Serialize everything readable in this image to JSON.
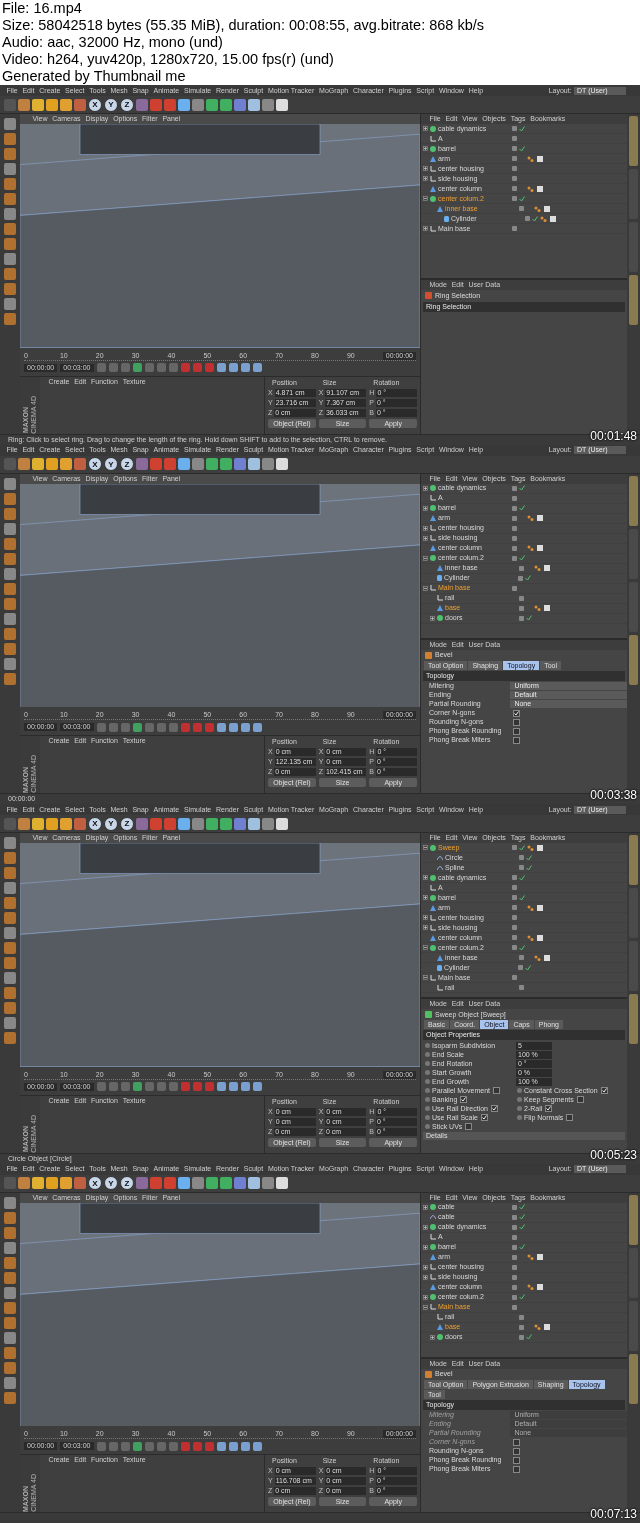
{
  "header": {
    "lines": [
      "File: 16.mp4",
      "Size: 58042518 bytes (55.35 MiB), duration: 00:08:55, avg.bitrate: 868 kb/s",
      "Audio: aac, 32000 Hz, mono (und)",
      "Video: h264, yuv420p, 1280x720, 15.00 fps(r) (und)",
      "Generated by Thumbnail me"
    ]
  },
  "frames": [
    {
      "timestamp": "00:01:48",
      "menu": [
        "File",
        "Edit",
        "Create",
        "Select",
        "Tools",
        "Mesh",
        "Snap",
        "Animate",
        "Simulate",
        "Render",
        "Sculpt",
        "Motion Tracker",
        "MoGraph",
        "Character",
        "Plugins",
        "Script",
        "Window",
        "Help"
      ],
      "layout_label": "Layout:",
      "layout_value": "DT (User)",
      "axis_buttons": [
        "X",
        "Y",
        "Z"
      ],
      "viewport_menu": [
        "View",
        "Cameras",
        "Display",
        "Options",
        "Filter",
        "Panel"
      ],
      "object_menu": [
        "File",
        "Edit",
        "View",
        "Objects",
        "Tags",
        "Bookmarks"
      ],
      "objects": [
        {
          "name": "cable dynamics",
          "kind": "sphere",
          "selected": false,
          "expanded": false,
          "check": true,
          "tags": false
        },
        {
          "name": "A",
          "kind": "null",
          "selected": false,
          "check": false,
          "tags": false
        },
        {
          "name": "barrel",
          "kind": "sphere",
          "selected": false,
          "expanded": false,
          "check": true,
          "tags": false
        },
        {
          "name": "arm",
          "kind": "bend",
          "selected": false,
          "check": false,
          "tags": true
        },
        {
          "name": "center housing",
          "kind": "null",
          "selected": false,
          "expanded": false,
          "check": false,
          "tags": false
        },
        {
          "name": "side housing",
          "kind": "null",
          "selected": false,
          "expanded": false,
          "check": false,
          "tags": false
        },
        {
          "name": "center column",
          "kind": "bend",
          "selected": false,
          "check": false,
          "tags": true
        },
        {
          "name": "center colum.2",
          "kind": "sphere",
          "selected": true,
          "expanded": true,
          "check": true,
          "tags": false,
          "children": [
            {
              "name": "inner base",
              "kind": "bend",
              "selected": true,
              "check": false,
              "tags": true,
              "children": [
                {
                  "name": "Cylinder",
                  "kind": "cylinder",
                  "selected": false,
                  "check": true,
                  "tags": true
                }
              ]
            }
          ]
        },
        {
          "name": "Main base",
          "kind": "null",
          "selected": false,
          "expanded": false,
          "check": false,
          "tags": false
        }
      ],
      "attr_menu": [
        "Mode",
        "Edit",
        "User Data"
      ],
      "attributes": {
        "kind": "ring",
        "title": "Ring Selection",
        "section": "Ring Selection"
      },
      "timeline": {
        "ticks": [
          "0",
          "10",
          "20",
          "30",
          "40",
          "50",
          "60",
          "70",
          "80",
          "90"
        ],
        "current": "00:00:00",
        "start": "00:00:00",
        "end": "00:03:00"
      },
      "material_menu": [
        "Create",
        "Edit",
        "Function",
        "Texture"
      ],
      "coords": {
        "headers": [
          "Position",
          "Size",
          "Rotation"
        ],
        "rows": [
          {
            "axis": "X",
            "position": "4.871 cm",
            "size_axis": "X",
            "size": "91.107 cm",
            "rot_axis": "H",
            "rotation": "0 °"
          },
          {
            "axis": "Y",
            "position": "23.716 cm",
            "size_axis": "Y",
            "size": "7.367 cm",
            "rot_axis": "P",
            "rotation": "0 °"
          },
          {
            "axis": "Z",
            "position": "0 cm",
            "size_axis": "Z",
            "size": "36.033 cm",
            "rot_axis": "B",
            "rotation": "0 °"
          }
        ],
        "mode": "Object (Rel)",
        "size_mode": "Size",
        "apply": "Apply"
      },
      "logo": [
        "MAXON",
        "CINEMA 4D"
      ],
      "status": "Ring: Click to select ring. Drag to change the length of the ring. Hold down SHIFT to add to the selection, CTRL to remove."
    },
    {
      "timestamp": "00:03:38",
      "menu": [
        "File",
        "Edit",
        "Create",
        "Select",
        "Tools",
        "Mesh",
        "Snap",
        "Animate",
        "Simulate",
        "Render",
        "Sculpt",
        "Motion Tracker",
        "MoGraph",
        "Character",
        "Plugins",
        "Script",
        "Window",
        "Help"
      ],
      "layout_label": "Layout:",
      "layout_value": "DT (User)",
      "axis_buttons": [
        "X",
        "Y",
        "Z"
      ],
      "viewport_menu": [
        "View",
        "Cameras",
        "Display",
        "Options",
        "Filter",
        "Panel"
      ],
      "object_menu": [
        "File",
        "Edit",
        "View",
        "Objects",
        "Tags",
        "Bookmarks"
      ],
      "objects": [
        {
          "name": "cable dynamics",
          "kind": "sphere",
          "selected": false,
          "expanded": false,
          "check": true,
          "tags": false
        },
        {
          "name": "A",
          "kind": "null",
          "selected": false,
          "check": false,
          "tags": false
        },
        {
          "name": "barrel",
          "kind": "sphere",
          "selected": false,
          "expanded": false,
          "check": true,
          "tags": false
        },
        {
          "name": "arm",
          "kind": "bend",
          "selected": false,
          "check": false,
          "tags": true
        },
        {
          "name": "center housing",
          "kind": "null",
          "selected": false,
          "expanded": false,
          "check": false,
          "tags": false
        },
        {
          "name": "side housing",
          "kind": "null",
          "selected": false,
          "expanded": false,
          "check": false,
          "tags": false
        },
        {
          "name": "center column",
          "kind": "bend",
          "selected": false,
          "check": false,
          "tags": true
        },
        {
          "name": "center colum.2",
          "kind": "sphere",
          "selected": false,
          "expanded": true,
          "check": true,
          "tags": false,
          "children": [
            {
              "name": "inner base",
              "kind": "bend",
              "selected": false,
              "check": false,
              "tags": true
            },
            {
              "name": "Cylinder",
              "kind": "cylinder",
              "selected": false,
              "check": true,
              "tags": false
            }
          ]
        },
        {
          "name": "Main base",
          "kind": "null",
          "selected": true,
          "expanded": true,
          "check": false,
          "tags": false,
          "children": [
            {
              "name": "rail",
              "kind": "null",
              "selected": false,
              "check": false,
              "tags": false
            },
            {
              "name": "base",
              "kind": "bend",
              "selected": true,
              "check": false,
              "tags": true
            },
            {
              "name": "doors",
              "kind": "sphere",
              "selected": false,
              "expanded": false,
              "check": true,
              "tags": false
            }
          ]
        }
      ],
      "attr_menu": [
        "Mode",
        "Edit",
        "User Data"
      ],
      "attributes": {
        "kind": "bevel",
        "title": "Bevel",
        "tabs": [
          {
            "label": "Tool Option",
            "selected": false
          },
          {
            "label": "Shaping",
            "selected": false
          },
          {
            "label": "Topology",
            "selected": true
          },
          {
            "label": "Tool",
            "selected": false
          }
        ],
        "section": "Topology",
        "fields": [
          {
            "kind": "dropdown",
            "label": "Mitering",
            "value": "Uniform",
            "disabled": false
          },
          {
            "kind": "dropdown",
            "label": "Ending",
            "value": "Default",
            "disabled": false
          },
          {
            "kind": "dropdown",
            "label": "Partial Rounding",
            "value": "None",
            "disabled": false
          },
          {
            "kind": "checkbox",
            "label": "Corner N-gons",
            "checked": true,
            "disabled": false
          },
          {
            "kind": "checkbox",
            "label": "Rounding N-gons",
            "checked": false,
            "disabled": false
          },
          {
            "kind": "checkbox",
            "label": "Phong Break Rounding",
            "checked": false,
            "disabled": false
          },
          {
            "kind": "checkbox",
            "label": "Phong Break Miters",
            "checked": false,
            "disabled": false
          }
        ]
      },
      "timeline": {
        "ticks": [
          "0",
          "10",
          "20",
          "30",
          "40",
          "50",
          "60",
          "70",
          "80",
          "90"
        ],
        "current": "00:00:00",
        "start": "00:00:00",
        "end": "00:03:00"
      },
      "material_menu": [
        "Create",
        "Edit",
        "Function",
        "Texture"
      ],
      "coords": {
        "headers": [
          "Position",
          "Size",
          "Rotation"
        ],
        "rows": [
          {
            "axis": "X",
            "position": "0 cm",
            "size_axis": "X",
            "size": "0 cm",
            "rot_axis": "H",
            "rotation": "0 °"
          },
          {
            "axis": "Y",
            "position": "122.135 cm",
            "size_axis": "Y",
            "size": "0 cm",
            "rot_axis": "P",
            "rotation": "0 °"
          },
          {
            "axis": "Z",
            "position": "0 cm",
            "size_axis": "Z",
            "size": "102.415 cm",
            "rot_axis": "B",
            "rotation": "0 °"
          }
        ],
        "mode": "Object (Rel)",
        "size_mode": "Size",
        "apply": "Apply"
      },
      "logo": [
        "MAXON",
        "CINEMA 4D"
      ],
      "status": "00:00:00"
    },
    {
      "timestamp": "00:05:23",
      "menu": [
        "File",
        "Edit",
        "Create",
        "Select",
        "Tools",
        "Mesh",
        "Snap",
        "Animate",
        "Simulate",
        "Render",
        "Sculpt",
        "Motion Tracker",
        "MoGraph",
        "Character",
        "Plugins",
        "Script",
        "Window",
        "Help"
      ],
      "layout_label": "Layout:",
      "layout_value": "DT (User)",
      "axis_buttons": [
        "X",
        "Y",
        "Z"
      ],
      "viewport_menu": [
        "View",
        "Cameras",
        "Display",
        "Options",
        "Filter",
        "Panel"
      ],
      "object_menu": [
        "File",
        "Edit",
        "View",
        "Objects",
        "Tags",
        "Bookmarks"
      ],
      "objects": [
        {
          "name": "Sweep",
          "kind": "sphere",
          "selected": true,
          "expanded": true,
          "check": true,
          "tags": true,
          "children": [
            {
              "name": "Circle",
              "kind": "spline",
              "selected": false,
              "check": true,
              "tags": false
            },
            {
              "name": "Spline",
              "kind": "spline",
              "selected": false,
              "check": true,
              "tags": false
            }
          ]
        },
        {
          "name": "cable dynamics",
          "kind": "sphere",
          "selected": false,
          "expanded": false,
          "check": true,
          "tags": false
        },
        {
          "name": "A",
          "kind": "null",
          "selected": false,
          "check": false,
          "tags": false
        },
        {
          "name": "barrel",
          "kind": "sphere",
          "selected": false,
          "expanded": false,
          "check": true,
          "tags": false
        },
        {
          "name": "arm",
          "kind": "bend",
          "selected": false,
          "check": false,
          "tags": true
        },
        {
          "name": "center housing",
          "kind": "null",
          "selected": false,
          "expanded": false,
          "check": false,
          "tags": false
        },
        {
          "name": "side housing",
          "kind": "null",
          "selected": false,
          "expanded": false,
          "check": false,
          "tags": false
        },
        {
          "name": "center column",
          "kind": "bend",
          "selected": false,
          "check": false,
          "tags": true
        },
        {
          "name": "center colum.2",
          "kind": "sphere",
          "selected": false,
          "expanded": true,
          "check": true,
          "tags": false,
          "children": [
            {
              "name": "inner base",
              "kind": "bend",
              "selected": false,
              "check": false,
              "tags": true
            },
            {
              "name": "Cylinder",
              "kind": "cylinder",
              "selected": false,
              "check": true,
              "tags": false
            }
          ]
        },
        {
          "name": "Main base",
          "kind": "null",
          "selected": false,
          "expanded": true,
          "check": false,
          "tags": false,
          "children": [
            {
              "name": "rail",
              "kind": "null",
              "selected": false,
              "check": false,
              "tags": false
            }
          ]
        }
      ],
      "attr_menu": [
        "Mode",
        "Edit",
        "User Data"
      ],
      "attributes": {
        "kind": "sweep",
        "title": "Sweep Object [Sweep]",
        "tabs": [
          {
            "label": "Basic",
            "selected": false
          },
          {
            "label": "Coord.",
            "selected": false
          },
          {
            "label": "Object",
            "selected": true
          },
          {
            "label": "Caps",
            "selected": false
          },
          {
            "label": "Phong",
            "selected": false
          }
        ],
        "section": "Object Properties",
        "fields": [
          {
            "kind": "number",
            "label": "Isoparm Subdivision",
            "value": "5"
          },
          {
            "kind": "number",
            "label": "End Scale",
            "value": "100 %"
          },
          {
            "kind": "number",
            "label": "End Rotation",
            "value": "0 °"
          },
          {
            "kind": "number",
            "label": "Start Growth",
            "value": "0 %"
          },
          {
            "kind": "number",
            "label": "End Growth",
            "value": "100 %"
          }
        ],
        "options": [
          {
            "label": "Parallel Movement",
            "checked": false
          },
          {
            "label": "Constant Cross Section",
            "checked": true
          },
          {
            "label": "Banking",
            "checked": true
          },
          {
            "label": "Keep Segments",
            "checked": false
          },
          {
            "label": "Use Rail Direction",
            "checked": true
          },
          {
            "label": "2-Rail",
            "checked": true
          },
          {
            "label": "Use Rail Scale",
            "checked": true
          },
          {
            "label": "Flip Normals",
            "checked": false
          },
          {
            "label": "Stick UVs",
            "checked": false
          }
        ],
        "details": "Details"
      },
      "timeline": {
        "ticks": [
          "0",
          "10",
          "20",
          "30",
          "40",
          "50",
          "60",
          "70",
          "80",
          "90"
        ],
        "current": "00:00:00",
        "start": "00:00:00",
        "end": "00:03:00"
      },
      "material_menu": [
        "Create",
        "Edit",
        "Function",
        "Texture"
      ],
      "coords": {
        "headers": [
          "Position",
          "Size",
          "Rotation"
        ],
        "rows": [
          {
            "axis": "X",
            "position": "0 cm",
            "size_axis": "X",
            "size": "0 cm",
            "rot_axis": "H",
            "rotation": "0 °"
          },
          {
            "axis": "Y",
            "position": "0 cm",
            "size_axis": "Y",
            "size": "0 cm",
            "rot_axis": "P",
            "rotation": "0 °"
          },
          {
            "axis": "Z",
            "position": "0 cm",
            "size_axis": "Z",
            "size": "0 cm",
            "rot_axis": "B",
            "rotation": "0 °"
          }
        ],
        "mode": "Object (Rel)",
        "size_mode": "Size",
        "apply": "Apply"
      },
      "logo": [
        "MAXON",
        "CINEMA 4D"
      ],
      "status": "Circle Object [Circle]"
    },
    {
      "timestamp": "00:07:13",
      "menu": [
        "File",
        "Edit",
        "Create",
        "Select",
        "Tools",
        "Mesh",
        "Snap",
        "Animate",
        "Simulate",
        "Render",
        "Sculpt",
        "Motion Tracker",
        "MoGraph",
        "Character",
        "Plugins",
        "Script",
        "Window",
        "Help"
      ],
      "layout_label": "Layout:",
      "layout_value": "DT (User)",
      "axis_buttons": [
        "X",
        "Y",
        "Z"
      ],
      "viewport_menu": [
        "View",
        "Cameras",
        "Display",
        "Options",
        "Filter",
        "Panel"
      ],
      "object_menu": [
        "File",
        "Edit",
        "View",
        "Objects",
        "Tags",
        "Bookmarks"
      ],
      "objects": [
        {
          "name": "cable",
          "kind": "sphere",
          "selected": false,
          "expanded": false,
          "check": true,
          "tags": false
        },
        {
          "name": "cable",
          "kind": "spline",
          "selected": false,
          "check": true,
          "tags": false
        },
        {
          "name": "cable dynamics",
          "kind": "sphere",
          "selected": false,
          "expanded": false,
          "check": true,
          "tags": false
        },
        {
          "name": "A",
          "kind": "null",
          "selected": false,
          "check": false,
          "tags": false
        },
        {
          "name": "barrel",
          "kind": "sphere",
          "selected": false,
          "expanded": false,
          "check": true,
          "tags": false
        },
        {
          "name": "arm",
          "kind": "bend",
          "selected": false,
          "check": false,
          "tags": true
        },
        {
          "name": "center housing",
          "kind": "null",
          "selected": false,
          "expanded": false,
          "check": false,
          "tags": false
        },
        {
          "name": "side housing",
          "kind": "null",
          "selected": false,
          "expanded": false,
          "check": false,
          "tags": false
        },
        {
          "name": "center column",
          "kind": "bend",
          "selected": false,
          "check": false,
          "tags": true
        },
        {
          "name": "center colum.2",
          "kind": "sphere",
          "selected": false,
          "expanded": false,
          "check": true,
          "tags": false
        },
        {
          "name": "Main base",
          "kind": "null",
          "selected": true,
          "expanded": true,
          "check": false,
          "tags": false,
          "children": [
            {
              "name": "rail",
              "kind": "null",
              "selected": false,
              "check": false,
              "tags": false
            },
            {
              "name": "base",
              "kind": "bend",
              "selected": true,
              "check": false,
              "tags": true
            },
            {
              "name": "doors",
              "kind": "sphere",
              "selected": false,
              "expanded": false,
              "check": true,
              "tags": false
            }
          ]
        }
      ],
      "attr_menu": [
        "Mode",
        "Edit",
        "User Data"
      ],
      "attributes": {
        "kind": "bevel",
        "title": "Bevel",
        "tabs": [
          {
            "label": "Tool Option",
            "selected": false
          },
          {
            "label": "Polygon Extrusion",
            "selected": false
          },
          {
            "label": "Shaping",
            "selected": false
          },
          {
            "label": "Topology",
            "selected": true
          },
          {
            "label": "Tool",
            "selected": false
          }
        ],
        "section": "Topology",
        "fields": [
          {
            "kind": "dropdown",
            "label": "Mitering",
            "value": "Uniform",
            "disabled": true
          },
          {
            "kind": "dropdown",
            "label": "Ending",
            "value": "Default",
            "disabled": true
          },
          {
            "kind": "dropdown",
            "label": "Partial Rounding",
            "value": "None",
            "disabled": true
          },
          {
            "kind": "checkbox",
            "label": "Corner N-gons",
            "checked": false,
            "disabled": true
          },
          {
            "kind": "checkbox",
            "label": "Rounding N-gons",
            "checked": false,
            "disabled": false
          },
          {
            "kind": "checkbox",
            "label": "Phong Break Rounding",
            "checked": false,
            "disabled": false
          },
          {
            "kind": "checkbox",
            "label": "Phong Break Miters",
            "checked": false,
            "disabled": false
          }
        ]
      },
      "timeline": {
        "ticks": [
          "0",
          "10",
          "20",
          "30",
          "40",
          "50",
          "60",
          "70",
          "80",
          "90"
        ],
        "current": "00:00:00",
        "start": "00:00:00",
        "end": "00:03:00"
      },
      "material_menu": [
        "Create",
        "Edit",
        "Function",
        "Texture"
      ],
      "coords": {
        "headers": [
          "Position",
          "Size",
          "Rotation"
        ],
        "rows": [
          {
            "axis": "X",
            "position": "0 cm",
            "size_axis": "X",
            "size": "0 cm",
            "rot_axis": "H",
            "rotation": "0 °"
          },
          {
            "axis": "Y",
            "position": "116.708 cm",
            "size_axis": "Y",
            "size": "0 cm",
            "rot_axis": "P",
            "rotation": "0 °"
          },
          {
            "axis": "Z",
            "position": "0 cm",
            "size_axis": "Z",
            "size": "0 cm",
            "rot_axis": "B",
            "rotation": "0 °"
          }
        ],
        "mode": "Object (Rel)",
        "size_mode": "Size",
        "apply": "Apply"
      },
      "logo": [
        "MAXON",
        "CINEMA 4D"
      ]
    }
  ]
}
